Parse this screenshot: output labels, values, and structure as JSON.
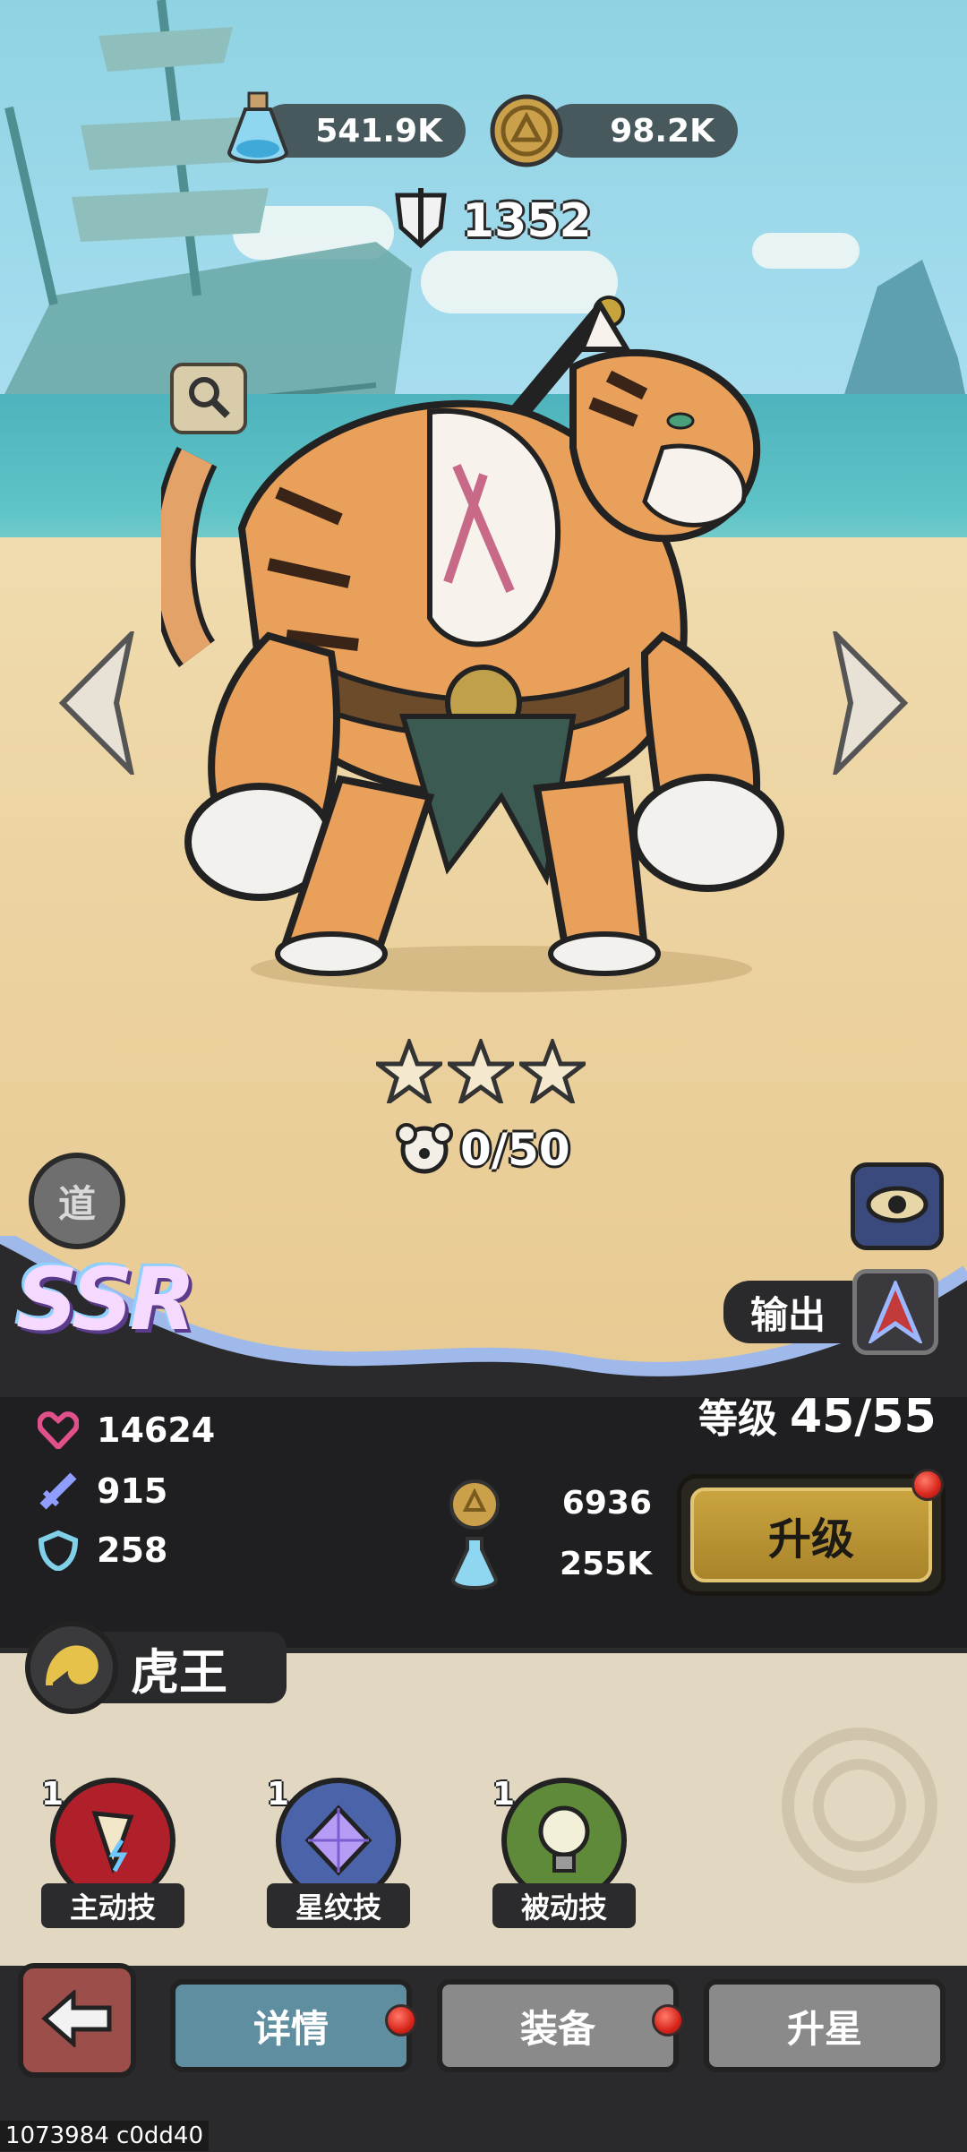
{
  "resources": {
    "potion": {
      "value": "541.9K",
      "icon": "potion-icon"
    },
    "coin": {
      "value": "98.2K",
      "icon": "coin-icon"
    }
  },
  "power": {
    "value": "1352",
    "icon": "sword-shield-icon"
  },
  "hero": {
    "rarity": "SSR",
    "faction_badge": "道",
    "role": "输出",
    "stars": 3,
    "shards": "0/50",
    "name": "虎王"
  },
  "stats": {
    "hp": "14624",
    "attack": "915",
    "defense": "258"
  },
  "level": {
    "label": "等级",
    "value": "45/55"
  },
  "upgrade_cost": {
    "coins": "6936",
    "potions": "255K"
  },
  "upgrade_button": {
    "label": "升级",
    "has_notification": true
  },
  "skills": [
    {
      "level": "1",
      "label": "主动技",
      "color": "#b0202a"
    },
    {
      "level": "1",
      "label": "星纹技",
      "color": "#4b63a8"
    },
    {
      "level": "1",
      "label": "被动技",
      "color": "#5f8a3a"
    }
  ],
  "tabs": [
    {
      "label": "详情",
      "active": true,
      "has_notification": true
    },
    {
      "label": "装备",
      "active": false,
      "has_notification": true
    },
    {
      "label": "升星",
      "active": false,
      "has_notification": false
    }
  ],
  "watermark": "1073984 c0dd40",
  "colors": {
    "accent": "#c9a43f",
    "panel": "#2a2a2c",
    "parchment": "#e2d8c2"
  }
}
